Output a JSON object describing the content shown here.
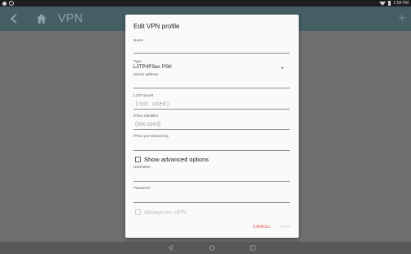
{
  "status_bar": {
    "time": "1:58 PM",
    "icons": [
      "notification-icon",
      "sync-icon",
      "wifi-icon",
      "battery-icon"
    ]
  },
  "app_bar": {
    "title": "VPN",
    "icons": [
      "back-arrow-icon",
      "home-icon",
      "add-icon"
    ],
    "colors": {
      "background": "#455f65",
      "title": "#8aa3a8"
    }
  },
  "dialog": {
    "title": "Edit VPN profile",
    "fields": {
      "name": {
        "label": "Name",
        "value": ""
      },
      "type": {
        "label": "Type",
        "value": "L2TP/IPSec PSK"
      },
      "server_address": {
        "label": "Server address",
        "value": ""
      },
      "l2tp_secret": {
        "label": "L2TP secret",
        "placeholder": "(not used)"
      },
      "ipsec_identifier": {
        "label": "IPSec identifier",
        "placeholder": "(not used)"
      },
      "ipsec_psk": {
        "label": "IPSec pre-shared key",
        "value": ""
      },
      "username": {
        "label": "Username",
        "value": ""
      },
      "password": {
        "label": "Password",
        "value": ""
      }
    },
    "show_advanced": {
      "label": "Show advanced options",
      "checked": false
    },
    "always_on": {
      "label": "Always-on VPN",
      "checked": false,
      "enabled": false
    },
    "buttons": {
      "cancel": "CANCEL",
      "save": "SAVE"
    },
    "colors": {
      "accent": "#d84a3e",
      "disabled": "#d2d2d2"
    }
  },
  "nav_bar": {
    "icons": [
      "nav-back-icon",
      "nav-home-icon",
      "nav-recents-icon"
    ]
  }
}
